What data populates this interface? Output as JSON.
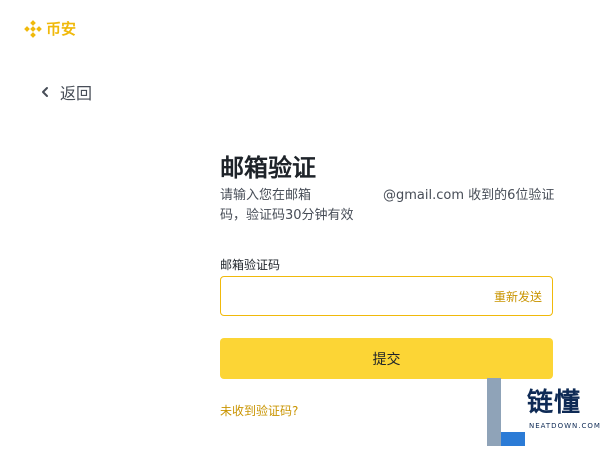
{
  "brand": {
    "name": "币安",
    "logo_icon": "binance-diamond-icon",
    "color": "#f0b90b"
  },
  "nav": {
    "back_label": "返回",
    "back_icon": "chevron-left-icon"
  },
  "verify": {
    "title": "邮箱验证",
    "message_before": "请输入您在邮箱",
    "message_after": "@gmail.com 收到的6位验证码，验证码30分钟有效",
    "field_label": "邮箱验证码",
    "code_value": "",
    "resend_label": "重新发送",
    "submit_label": "提交",
    "not_received_label": "未收到验证码?"
  },
  "colors": {
    "accent": "#fcd535",
    "link": "#c99400",
    "input_border": "#f0b90b"
  },
  "watermark": {
    "text": "链懂",
    "domain": "NEATDOWN.COM"
  }
}
